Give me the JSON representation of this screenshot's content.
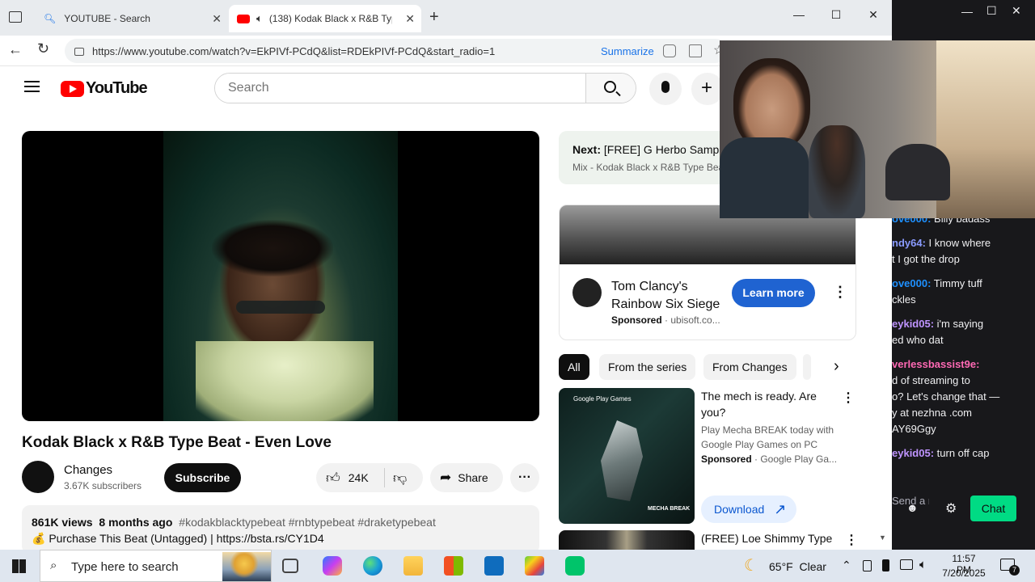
{
  "browser": {
    "tabs": [
      {
        "title": "YOUTUBE - Search"
      },
      {
        "title": "(138) Kodak Black x R&B Typ"
      }
    ],
    "url": "https://www.youtube.com/watch?v=EkPIVf-PCdQ&list=RDEkPIVf-PCdQ&start_radio=1",
    "summarize_label": "Summarize"
  },
  "youtube": {
    "logo_text": "YouTube",
    "search_placeholder": "Search",
    "video": {
      "title": "Kodak Black x R&B Type Beat - Even Love",
      "channel": "Changes",
      "subscribers": "3.67K subscribers",
      "subscribe_label": "Subscribe",
      "likes": "24K",
      "share_label": "Share",
      "views": "861K views",
      "age": "8 months ago",
      "hashtags": "#kodakblacktypebeat #rnbtypebeat #draketypebeat",
      "description_line": "Purchase This Beat (Untagged) | https://bsta.rs/CY1D4",
      "description_emoji": "💰"
    },
    "next_up": {
      "label": "Next:",
      "title": "[FREE] G Herbo Sample",
      "subtitle": "Mix - Kodak Black x R&B Type Beat"
    },
    "ad": {
      "line1": "Tom Clancy's",
      "line2": "Rainbow Six Siege",
      "sponsored": "Sponsored",
      "domain": "· ubisoft.co...",
      "cta": "Learn more"
    },
    "chips": [
      "All",
      "From the series",
      "From Changes"
    ],
    "promo": {
      "title_line1": "The mech is ready. Are",
      "title_line2": "you?",
      "desc_line1": "Play Mecha BREAK today with",
      "desc_line2": "Google Play Games on PC",
      "sponsored": "Sponsored",
      "source": "· Google Play Ga...",
      "cta": "Download",
      "thumb_badge": "Google Play Games",
      "thumb_logo": "MECHA BREAK"
    },
    "next_video_title": "(FREE) Loe Shimmy Type"
  },
  "chat": {
    "messages": [
      {
        "user": "ove000:",
        "text": "Billy badass",
        "color": "#1e90ff"
      },
      {
        "user": "ndy64:",
        "text": "I know where",
        "color": "#8a9bff"
      },
      {
        "user": "",
        "text": "t I got the drop",
        "color": "#efeff1"
      },
      {
        "user": "ove000:",
        "text": "Timmy tuff",
        "color": "#1e90ff"
      },
      {
        "user": "",
        "text": "ckles",
        "color": "#efeff1"
      },
      {
        "user": "eykid05:",
        "text": "i'm saying",
        "color": "#bf94ff"
      },
      {
        "user": "",
        "text": "ed who dat",
        "color": "#efeff1"
      },
      {
        "user": "verlessbassist9e:",
        "text": "",
        "color": "#ff69b4"
      },
      {
        "user": "",
        "text": "d of streaming to",
        "color": "#efeff1"
      },
      {
        "user": "",
        "text": "o? Let's change that —",
        "color": "#efeff1"
      },
      {
        "user": "",
        "text": "y at nezhna .com",
        "color": "#efeff1"
      },
      {
        "user": "",
        "text": "AY69Ggy",
        "color": "#efeff1"
      },
      {
        "user": "eykid05:",
        "text": "turn off cap",
        "color": "#bf94ff"
      }
    ],
    "input_placeholder": "Send a message",
    "chat_button": "Chat"
  },
  "taskbar": {
    "search_placeholder": "Type here to search",
    "weather": "65°F  Clear",
    "time": "11:57 PM",
    "date": "7/20/2025",
    "notification_count": "7"
  },
  "colors": {
    "youtube_red": "#ff0000",
    "chat_green": "#00db84",
    "learn_more_blue": "#1f63d1"
  }
}
